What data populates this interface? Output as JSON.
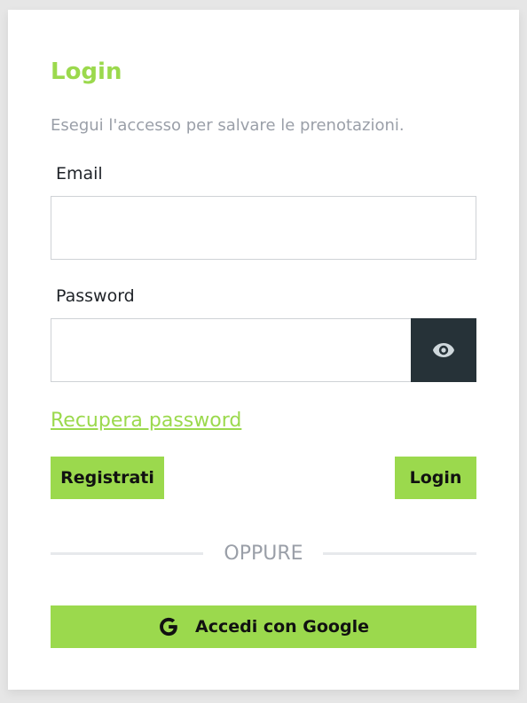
{
  "colors": {
    "accent": "#9bd94d",
    "dark_button": "#263238",
    "muted_text": "#9a9fa8"
  },
  "login": {
    "title": "Login",
    "subtitle": "Esegui l'accesso per salvare le prenotazioni.",
    "email": {
      "label": "Email",
      "value": "",
      "placeholder": ""
    },
    "password": {
      "label": "Password",
      "value": "",
      "placeholder": "",
      "toggle_icon": "eye-icon"
    },
    "recover_link": "Recupera password",
    "register_button": "Registrati",
    "login_button": "Login",
    "divider_text": "OPPURE",
    "google_button": {
      "label": "Accedi con Google",
      "icon": "google-icon"
    }
  }
}
